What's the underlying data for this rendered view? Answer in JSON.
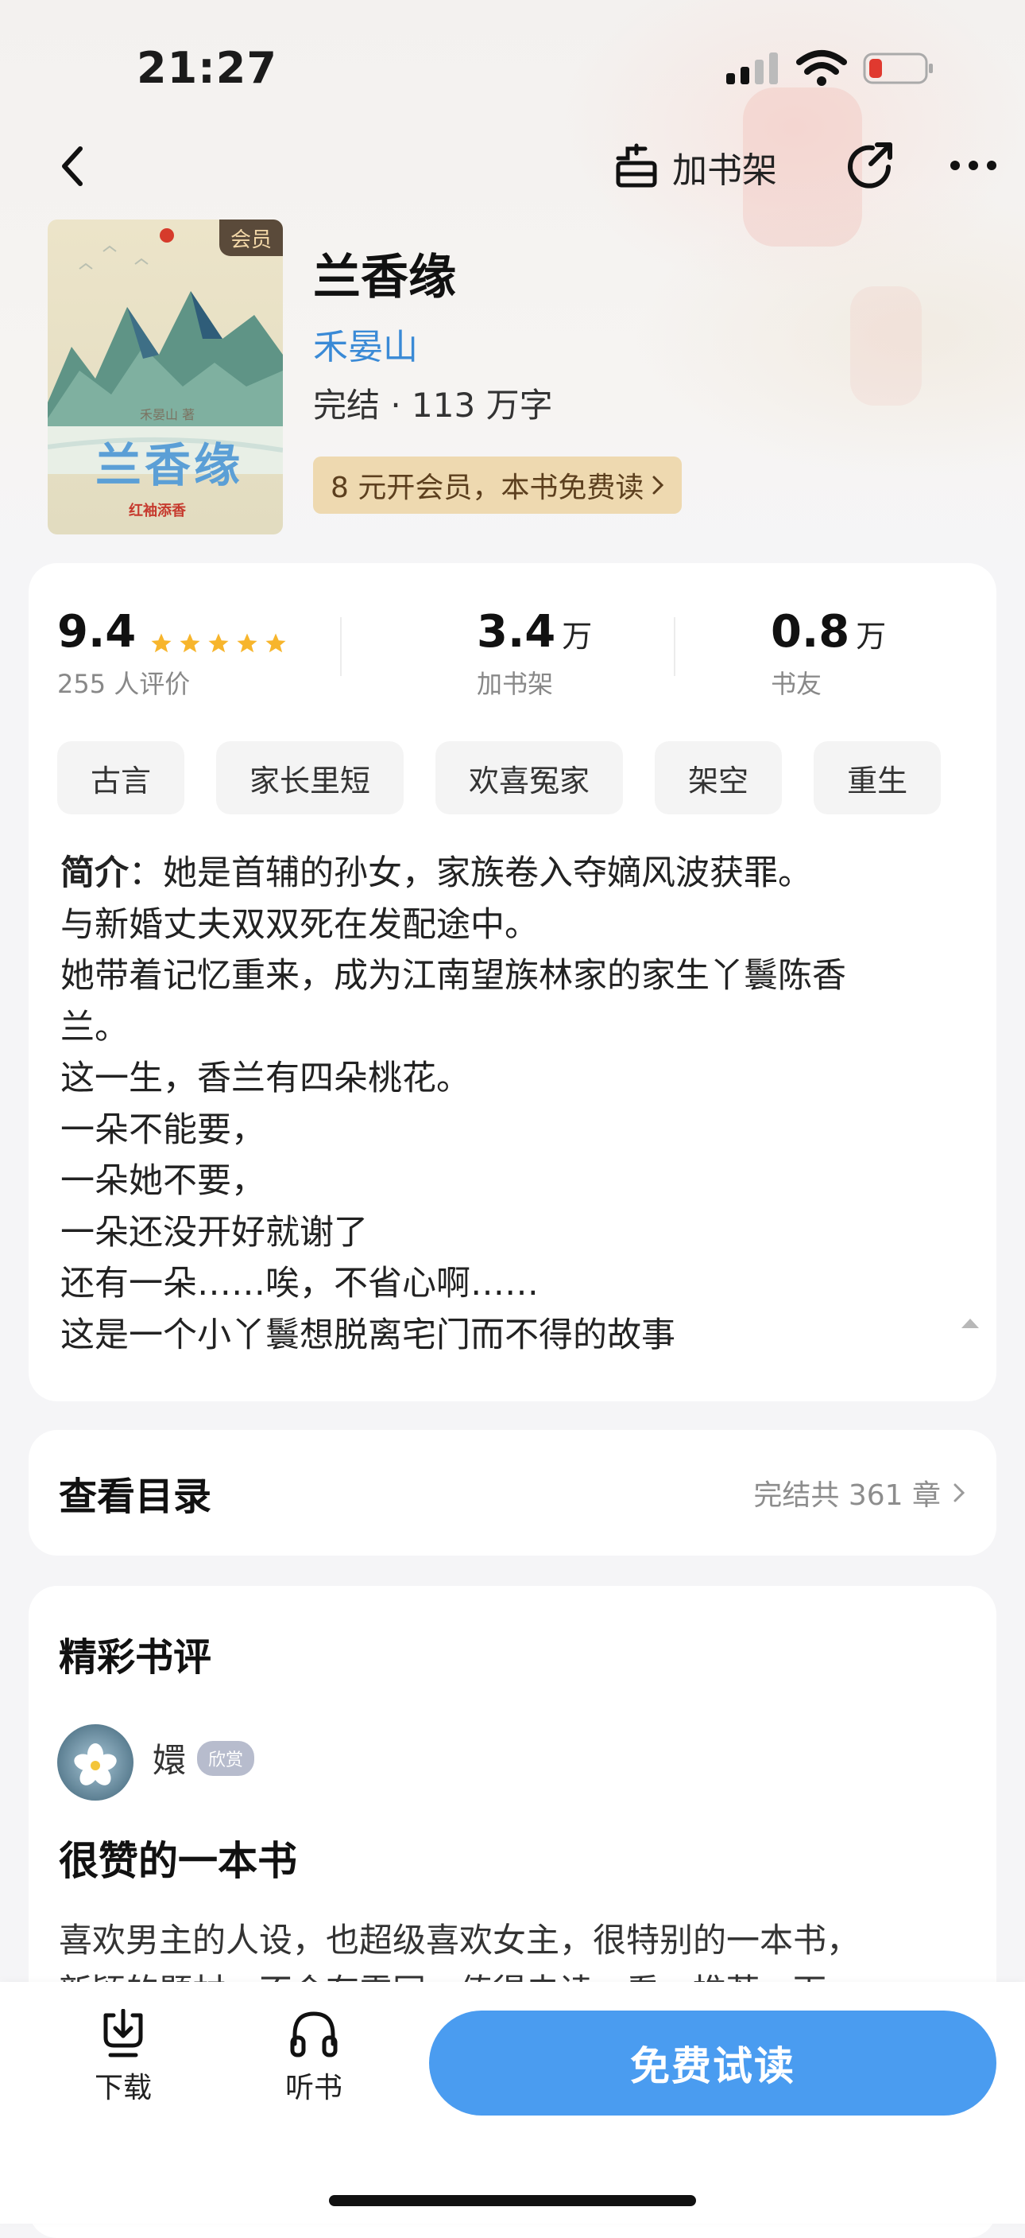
{
  "status_bar": {
    "time": "21:27"
  },
  "nav": {
    "add_shelf_label": "加书架"
  },
  "book": {
    "cover_badge": "会员",
    "cover_title": "兰香缘",
    "cover_author": "禾晏山 著",
    "cover_publisher": "红袖添香",
    "title": "兰香缘",
    "author": "禾晏山",
    "meta": "完结 · 113 万字",
    "vip_promo": "8 元开会员，本书免费读"
  },
  "stats": {
    "rating": "9.4",
    "rating_stars": 5,
    "rating_count": "255 人评价",
    "shelf_num": "3.4",
    "shelf_unit": "万",
    "shelf_label": "加书架",
    "fans_num": "0.8",
    "fans_unit": "万",
    "fans_label": "书友"
  },
  "tags": [
    "古言",
    "家长里短",
    "欢喜冤家",
    "架空",
    "重生"
  ],
  "intro": {
    "prefix": "简介",
    "lines": [
      "：她是首辅的孙女，家族卷入夺嫡风波获罪。",
      "与新婚丈夫双双死在发配途中。",
      "她带着记忆重来，成为江南望族林家的家生丫鬟陈香",
      "兰。",
      "这一生，香兰有四朵桃花。",
      "一朵不能要，",
      "一朵她不要，",
      "一朵还没开好就谢了",
      "还有一朵……唉，不省心啊……",
      "这是一个小丫鬟想脱离宅门而不得的故事"
    ]
  },
  "toc": {
    "title": "查看目录",
    "summary": "完结共 361 章"
  },
  "reviews": {
    "heading": "精彩书评",
    "user": "嬛",
    "badge": "欣赏",
    "title": "很赞的一本书",
    "body_lines": [
      "喜欢男主的人设，也超级喜欢女主，很特别的一本书，",
      "新颖的题材，不会有雷同，值得去读一看，推荐一下"
    ]
  },
  "bottom_bar": {
    "download_label": "下载",
    "listen_label": "听书",
    "read_button": "免费试读"
  }
}
